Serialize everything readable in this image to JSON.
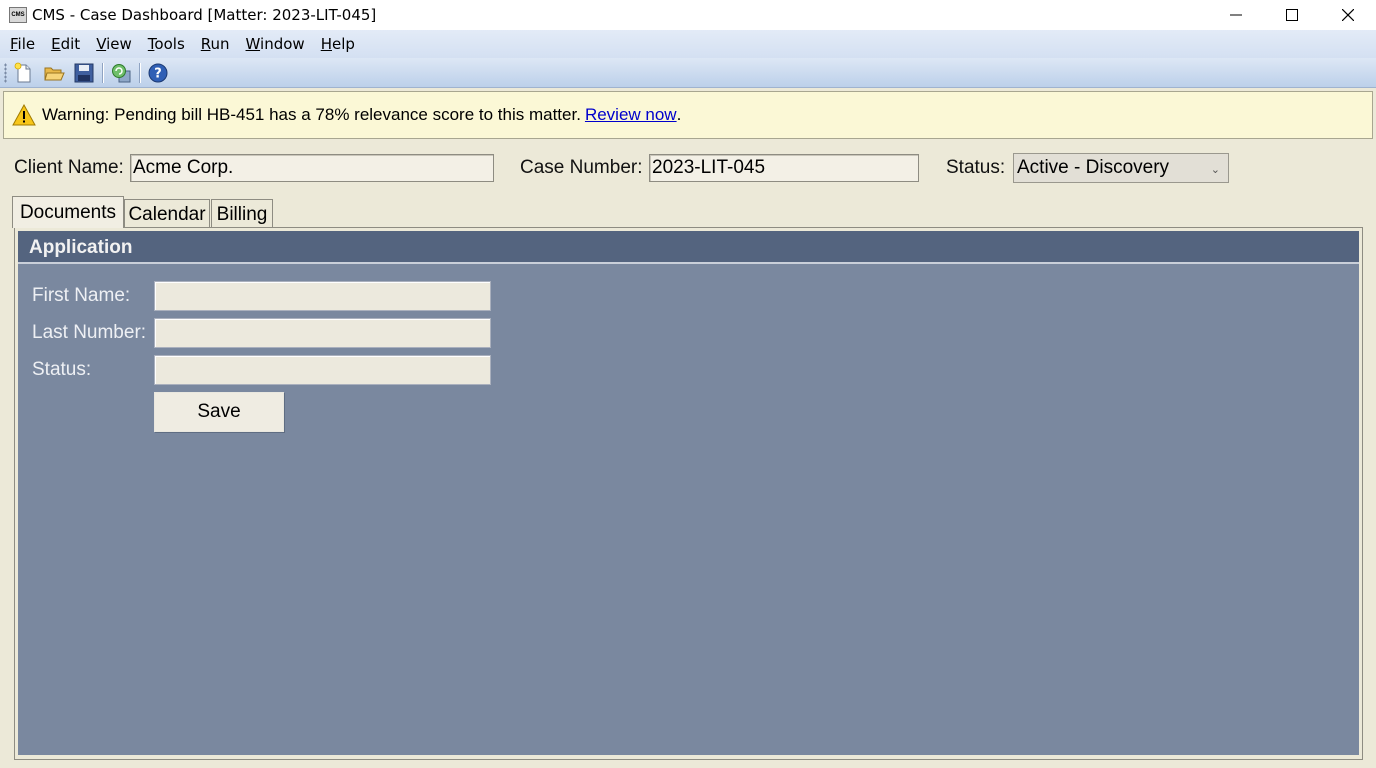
{
  "window": {
    "icon_text": "CMS",
    "title": "CMS - Case Dashboard [Matter: 2023-LIT-045]"
  },
  "menu": [
    {
      "mnemonic": "F",
      "rest": "ile"
    },
    {
      "mnemonic": "E",
      "rest": "dit"
    },
    {
      "mnemonic": "V",
      "rest": "iew"
    },
    {
      "mnemonic": "T",
      "rest": "ools"
    },
    {
      "mnemonic": "R",
      "rest": "un"
    },
    {
      "mnemonic": "W",
      "rest": "indow"
    },
    {
      "mnemonic": "H",
      "rest": "elp"
    }
  ],
  "toolbar": {
    "icons": [
      "new-document-icon",
      "open-folder-icon",
      "save-icon",
      "refresh-icon",
      "help-icon"
    ]
  },
  "warning": {
    "icon": "warning-icon",
    "text": "Warning: Pending bill HB-451 has a 78% relevance score to this matter.",
    "link": "Review now",
    "suffix": "."
  },
  "case": {
    "client_label": "Client Name:",
    "client_value": "Acme Corp.",
    "case_label": "Case Number:",
    "case_value": "2023-LIT-045",
    "status_label": "Status:",
    "status_value": "Active - Discovery"
  },
  "tabs": [
    {
      "label": "Documents",
      "active": true
    },
    {
      "label": "Calendar",
      "active": false
    },
    {
      "label": "Billing",
      "active": false
    }
  ],
  "panel": {
    "title": "Application",
    "first_name_label": "First Name:",
    "first_name_value": "",
    "last_label": "Last Number:",
    "last_value": "",
    "status_label": "Status:",
    "status_value": "",
    "save_label": "Save"
  },
  "colors": {
    "panel_bg": "#7a889f",
    "panel_header": "#54647f",
    "warning_bg": "#fbf8d6",
    "link": "#0000cc"
  }
}
